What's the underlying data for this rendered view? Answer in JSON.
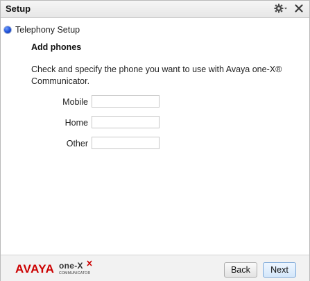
{
  "window": {
    "title": "Setup"
  },
  "titlebar": {
    "gear_icon": "gear-dropdown-icon",
    "close_icon": "close-icon"
  },
  "step": {
    "label": "Telephony Setup",
    "indicator_color": "#1d4fd6"
  },
  "content": {
    "heading": "Add phones",
    "instructions": "Check and specify the phone you want to use with Avaya one-X® Communicator.",
    "fields": [
      {
        "label": "Mobile",
        "value": ""
      },
      {
        "label": "Home",
        "value": ""
      },
      {
        "label": "Other",
        "value": ""
      }
    ]
  },
  "footer": {
    "brand": "AVAYA",
    "product": "one-X",
    "product_sub": "COMMUNICATOR",
    "brand_color": "#cc0000",
    "back_label": "Back",
    "next_label": "Next"
  }
}
